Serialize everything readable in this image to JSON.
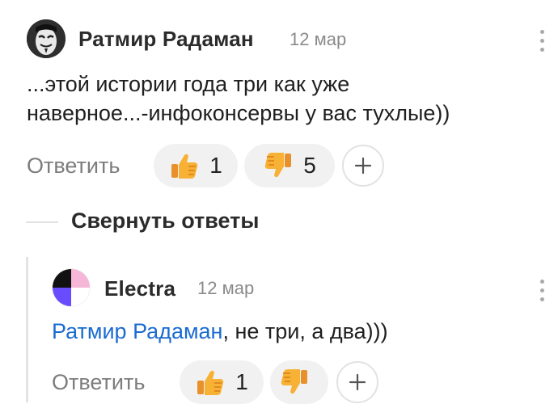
{
  "comments": [
    {
      "author": "Ратмир Радаман",
      "date": "12 мар",
      "text_line1": "...этой истории года три как уже",
      "text_line2": "наверное...-инфоконсервы у вас тухлые))",
      "reply_label": "Ответить",
      "likes": "1",
      "dislikes": "5",
      "avatar_icon": "anonymous-mask-avatar"
    },
    {
      "author": "Electra",
      "date": "12 мар",
      "mention": "Ратмир Радаман",
      "text_rest": ", не три, а два)))",
      "reply_label": "Ответить",
      "likes": "1",
      "dislikes": "",
      "avatar_icon": "quadrant-logo-avatar"
    }
  ],
  "collapse_label": "Свернуть ответы",
  "icons": {
    "like": "thumbs-up-icon",
    "dislike": "thumbs-down-icon",
    "add_reaction": "plus-icon",
    "more": "vertical-dots-icon"
  },
  "colors": {
    "mention": "#1a6bd1",
    "pill_bg": "#f1f1f1",
    "thumb": "#f5a623"
  }
}
